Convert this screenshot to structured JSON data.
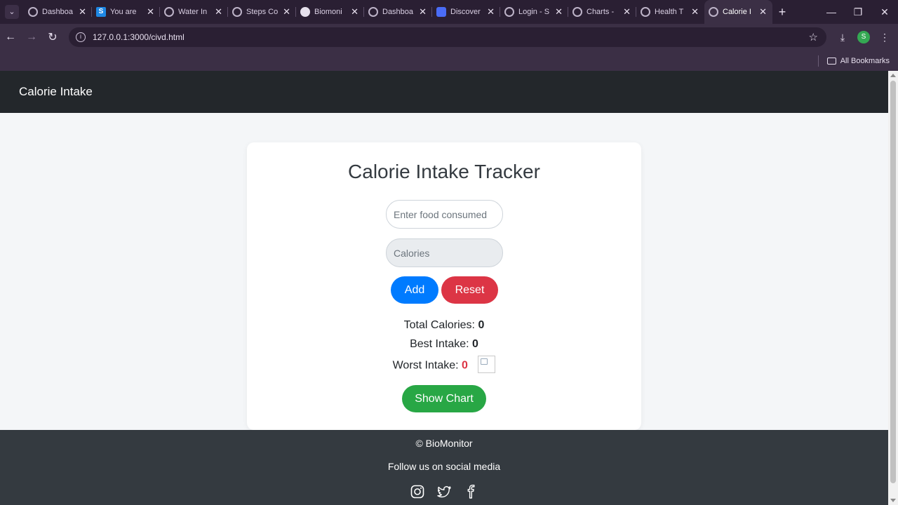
{
  "browser": {
    "tabs": [
      {
        "title": "Dashboa",
        "icon": "globe-icon"
      },
      {
        "title": "You are",
        "icon": "s-logo-icon"
      },
      {
        "title": "Water In",
        "icon": "globe-icon"
      },
      {
        "title": "Steps Co",
        "icon": "globe-icon"
      },
      {
        "title": "Biomoni",
        "icon": "github-icon"
      },
      {
        "title": "Dashboa",
        "icon": "globe-icon"
      },
      {
        "title": "Discover",
        "icon": "doc-icon"
      },
      {
        "title": "Login - S",
        "icon": "globe-icon"
      },
      {
        "title": "Charts -",
        "icon": "globe-icon"
      },
      {
        "title": "Health T",
        "icon": "globe-icon"
      },
      {
        "title": "Calorie I",
        "icon": "globe-icon",
        "active": true
      }
    ],
    "url": "127.0.0.1:3000/civd.html",
    "profile_initial": "S",
    "bookmarks_label": "All Bookmarks"
  },
  "navbar": {
    "brand": "Calorie Intake"
  },
  "tracker": {
    "title": "Calorie Intake Tracker",
    "food_placeholder": "Enter food consumed",
    "calories_placeholder": "Calories",
    "add_label": "Add",
    "reset_label": "Reset",
    "total_label": "Total Calories:",
    "total_value": "0",
    "best_label": "Best Intake:",
    "best_value": "0",
    "worst_label": "Worst Intake:",
    "worst_value": "0",
    "show_chart_label": "Show Chart"
  },
  "footer": {
    "copyright": "© BioMonitor",
    "follow_text": "Follow us on social media",
    "social": [
      "instagram-icon",
      "twitter-icon",
      "facebook-icon"
    ]
  },
  "colors": {
    "add": "#007bff",
    "reset": "#dc3545",
    "show_chart": "#28a745",
    "navbar": "#23272b",
    "footer": "#343a40"
  }
}
